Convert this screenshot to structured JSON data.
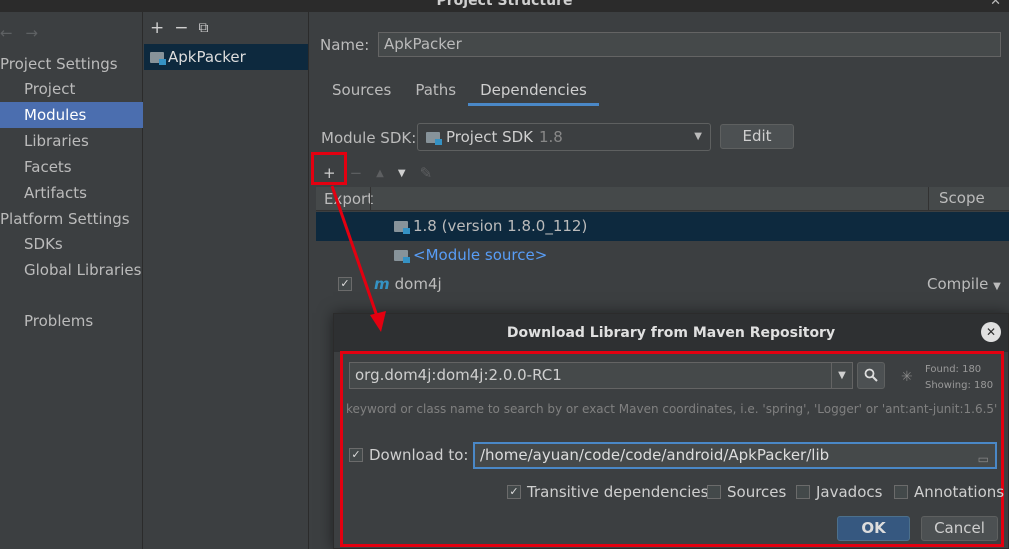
{
  "window": {
    "title": "Project Structure",
    "close_glyph": "✕"
  },
  "left_nav": {
    "arrows": [
      "←",
      "→"
    ],
    "sections": [
      {
        "label": "Project Settings"
      },
      {
        "label": "Platform Settings"
      }
    ],
    "items": [
      {
        "label": "Project"
      },
      {
        "label": "Modules"
      },
      {
        "label": "Libraries"
      },
      {
        "label": "Facets"
      },
      {
        "label": "Artifacts"
      },
      {
        "label": "SDKs"
      },
      {
        "label": "Global Libraries"
      },
      {
        "label": "Problems"
      }
    ]
  },
  "modules_pane": {
    "toolbar": {
      "add": "+",
      "remove": "−",
      "copy": "⧉"
    },
    "module": "ApkPacker"
  },
  "module_settings": {
    "name_label": "Name:",
    "name_value": "ApkPacker",
    "tabs": [
      "Sources",
      "Paths",
      "Dependencies"
    ],
    "sdk_label": "Module SDK:",
    "sdk_value": "Project SDK",
    "sdk_version": "1.8",
    "edit_label": "Edit",
    "dep_toolbar": {
      "add": "+",
      "remove": "−",
      "up": "▲",
      "down": "▼",
      "edit": "✎"
    },
    "columns": {
      "export": "Export",
      "scope": "Scope"
    },
    "dependencies": [
      {
        "label": "1.8 (version 1.8.0_112)"
      },
      {
        "label": "<Module source>"
      },
      {
        "label": "dom4j",
        "scope": "Compile",
        "exported": "✓"
      }
    ]
  },
  "dialog": {
    "title": "Download Library from Maven Repository",
    "close": "✕",
    "search_value": "org.dom4j:dom4j:2.0.0-RC1",
    "found": "Found: 180",
    "showing": "Showing: 180",
    "hint": "keyword or class name to search by or exact Maven coordinates, i.e. 'spring', 'Logger' or 'ant:ant-junit:1.6.5'",
    "download_label": "Download to:",
    "download_path": "/home/ayuan/code/code/android/ApkPacker/lib",
    "options": [
      {
        "label": "Transitive dependencies",
        "checked": "✓"
      },
      {
        "label": "Sources",
        "checked": ""
      },
      {
        "label": "Javadocs",
        "checked": ""
      },
      {
        "label": "Annotations",
        "checked": ""
      }
    ],
    "ok_label": "OK",
    "cancel_label": "Cancel"
  },
  "colors": {
    "highlight": "#e30010",
    "selection": "#4b6eaf",
    "link": "#589df6"
  }
}
